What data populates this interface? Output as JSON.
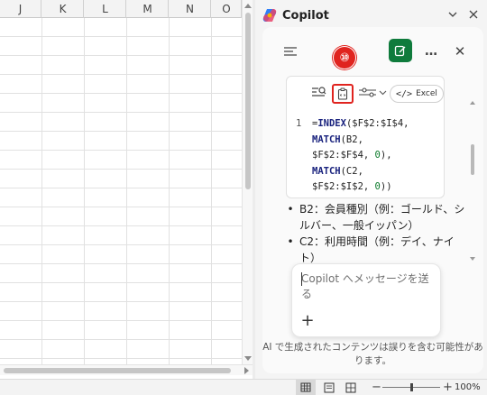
{
  "sheet": {
    "columns": [
      "J",
      "K",
      "L",
      "M",
      "N",
      "O"
    ]
  },
  "copilot": {
    "title": "Copilot",
    "menu_icon": "hamburger-icon",
    "new_chat_icon": "new-chat-icon",
    "more_label": "…",
    "close_label": "✕",
    "code_block": {
      "toolbar": {
        "excel_label": "Excel"
      },
      "annotation_number": "⑩",
      "line_number": "1",
      "lines": [
        {
          "parts": [
            {
              "t": "=",
              "c": "plain"
            },
            {
              "t": "INDEX",
              "c": "fn"
            },
            {
              "t": "($F$2:$I$4,",
              "c": "plain"
            }
          ]
        },
        {
          "parts": [
            {
              "t": "MATCH",
              "c": "fn"
            },
            {
              "t": "(B2,",
              "c": "plain"
            }
          ]
        },
        {
          "parts": [
            {
              "t": "$F$2:$F$4, ",
              "c": "plain"
            },
            {
              "t": "0",
              "c": "num"
            },
            {
              "t": "),",
              "c": "plain"
            }
          ]
        },
        {
          "parts": [
            {
              "t": "MATCH",
              "c": "fn"
            },
            {
              "t": "(C2,",
              "c": "plain"
            }
          ]
        },
        {
          "parts": [
            {
              "t": "$F$2:$I$2, ",
              "c": "plain"
            },
            {
              "t": "0",
              "c": "num"
            },
            {
              "t": "))",
              "c": "plain"
            }
          ]
        }
      ]
    },
    "bullets": [
      "B2：会員種別（例：ゴールド、シルバー、一般イッパン）",
      "C2：利用時間（例：デイ、ナイト）"
    ],
    "input": {
      "placeholder": "Copilot へメッセージを送る"
    },
    "disclaimer": "AI で生成されたコンテンツは誤りを含む可能性があります。"
  },
  "status_bar": {
    "zoom_level": "100%",
    "zoom_fraction": 0.5
  }
}
